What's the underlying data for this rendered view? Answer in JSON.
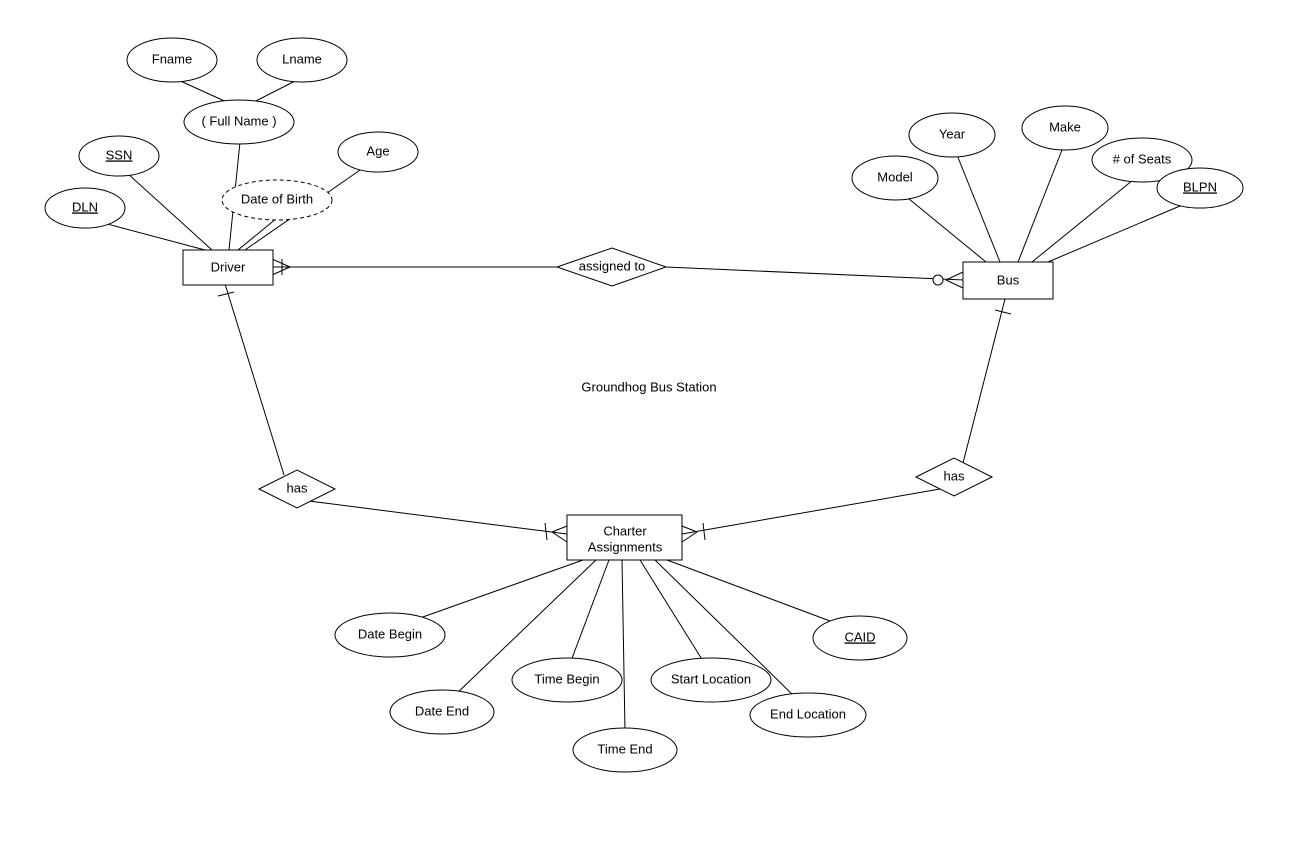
{
  "title": "Groundhog Bus Station",
  "entities": {
    "driver": {
      "label": "Driver"
    },
    "bus": {
      "label": "Bus"
    },
    "charter": {
      "label_line1": "Charter",
      "label_line2": "Assignments"
    }
  },
  "relationships": {
    "assigned_to": {
      "label": "assigned to"
    },
    "has_left": {
      "label": "has"
    },
    "has_right": {
      "label": "has"
    }
  },
  "attributes": {
    "driver": {
      "fname": "Fname",
      "lname": "Lname",
      "fullname": "( Full Name )",
      "age": "Age",
      "ssn": "SSN",
      "dln": "DLN",
      "dob": "Date of Birth"
    },
    "bus": {
      "year": "Year",
      "make": "Make",
      "model": "Model",
      "seats": "# of Seats",
      "blpn": "BLPN"
    },
    "charter": {
      "date_begin": "Date Begin",
      "date_end": "Date End",
      "time_begin": "Time Begin",
      "time_end": "Time End",
      "start_loc": "Start Location",
      "end_loc": "End Location",
      "caid": "CAID"
    }
  }
}
